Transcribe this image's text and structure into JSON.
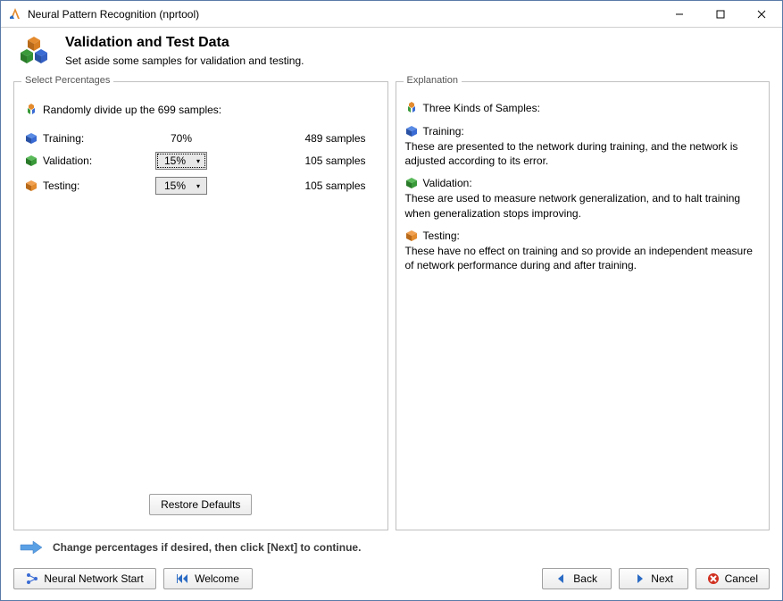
{
  "window": {
    "title": "Neural Pattern Recognition (nprtool)"
  },
  "header": {
    "title": "Validation and Test Data",
    "subtitle": "Set aside some samples for validation and testing."
  },
  "left_panel": {
    "title": "Select Percentages",
    "divide_text": "Randomly divide up the 699 samples:",
    "rows": {
      "training": {
        "label": "Training:",
        "value": "70%",
        "samples": "489 samples"
      },
      "validation": {
        "label": "Validation:",
        "value": "15%",
        "samples": "105 samples"
      },
      "testing": {
        "label": "Testing:",
        "value": "15%",
        "samples": "105 samples"
      }
    },
    "restore_btn": "Restore Defaults"
  },
  "right_panel": {
    "title": "Explanation",
    "heading": "Three Kinds of Samples:",
    "training": {
      "label": "Training:",
      "text": "These are presented to the network during training, and the network is adjusted according to its error."
    },
    "validation": {
      "label": "Validation:",
      "text": "These are used to measure network generalization, and to halt training when generalization stops improving."
    },
    "testing": {
      "label": "Testing:",
      "text": "These have no effect on training and so provide an independent measure of network performance during and after training."
    }
  },
  "hint": "Change percentages if desired, then click [Next] to continue.",
  "footer": {
    "nn_start": "Neural Network Start",
    "welcome": "Welcome",
    "back": "Back",
    "next": "Next",
    "cancel": "Cancel"
  }
}
